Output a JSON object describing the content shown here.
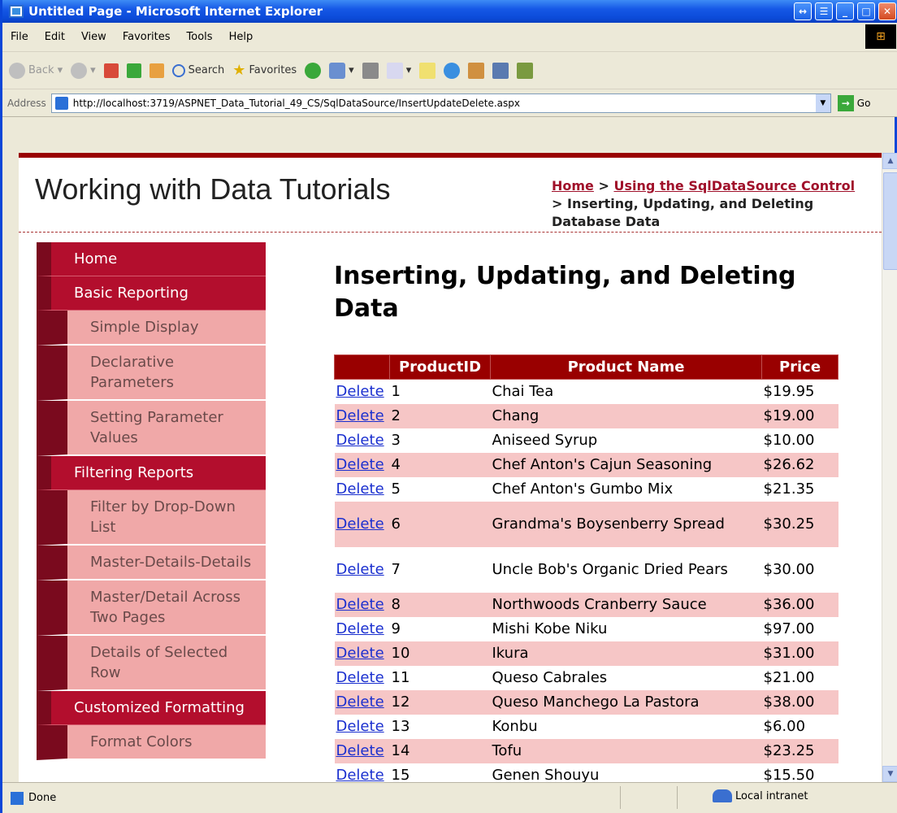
{
  "window": {
    "title": "Untitled Page - Microsoft Internet Explorer"
  },
  "menubar": {
    "items": [
      "File",
      "Edit",
      "View",
      "Favorites",
      "Tools",
      "Help"
    ]
  },
  "toolbar": {
    "back": "Back",
    "search": "Search",
    "favorites": "Favorites"
  },
  "address": {
    "label": "Address",
    "url": "http://localhost:3719/ASPNET_Data_Tutorial_49_CS/SqlDataSource/InsertUpdateDelete.aspx",
    "go": "Go"
  },
  "header": {
    "site_title": "Working with Data Tutorials",
    "crumb_home": "Home",
    "crumb_sep1": " > ",
    "crumb_section": "Using the SqlDataSource Control",
    "crumb_sep2": " > ",
    "crumb_current": "Inserting, Updating, and Deleting Database Data"
  },
  "menu": [
    {
      "label": "Home",
      "level": 1
    },
    {
      "label": "Basic Reporting",
      "level": 1
    },
    {
      "label": "Simple Display",
      "level": 2
    },
    {
      "label": "Declarative Parameters",
      "level": 2
    },
    {
      "label": "Setting Parameter Values",
      "level": 2
    },
    {
      "label": "Filtering Reports",
      "level": 1
    },
    {
      "label": "Filter by Drop-Down List",
      "level": 2
    },
    {
      "label": "Master-Details-Details",
      "level": 2
    },
    {
      "label": "Master/Detail Across Two Pages",
      "level": 2
    },
    {
      "label": "Details of Selected Row",
      "level": 2
    },
    {
      "label": "Customized Formatting",
      "level": 1
    },
    {
      "label": "Format Colors",
      "level": 2
    }
  ],
  "content": {
    "heading": "Inserting, Updating, and Deleting Data"
  },
  "grid": {
    "columns": [
      "",
      "ProductID",
      "Product Name",
      "Price"
    ],
    "delete_label": "Delete",
    "rows": [
      {
        "id": "1",
        "name": "Chai Tea",
        "price": "$19.95"
      },
      {
        "id": "2",
        "name": "Chang",
        "price": "$19.00"
      },
      {
        "id": "3",
        "name": "Aniseed Syrup",
        "price": "$10.00"
      },
      {
        "id": "4",
        "name": "Chef Anton's Cajun Seasoning",
        "price": "$26.62"
      },
      {
        "id": "5",
        "name": "Chef Anton's Gumbo Mix",
        "price": "$21.35"
      },
      {
        "id": "6",
        "name": "Grandma's Boysenberry Spread",
        "price": "$30.25"
      },
      {
        "id": "7",
        "name": "Uncle Bob's Organic Dried Pears",
        "price": "$30.00"
      },
      {
        "id": "8",
        "name": "Northwoods Cranberry Sauce",
        "price": "$36.00"
      },
      {
        "id": "9",
        "name": "Mishi Kobe Niku",
        "price": "$97.00"
      },
      {
        "id": "10",
        "name": "Ikura",
        "price": "$31.00"
      },
      {
        "id": "11",
        "name": "Queso Cabrales",
        "price": "$21.00"
      },
      {
        "id": "12",
        "name": "Queso Manchego La Pastora",
        "price": "$38.00"
      },
      {
        "id": "13",
        "name": "Konbu",
        "price": "$6.00"
      },
      {
        "id": "14",
        "name": "Tofu",
        "price": "$23.25"
      },
      {
        "id": "15",
        "name": "Genen Shouyu",
        "price": "$15.50"
      }
    ]
  },
  "status": {
    "text": "Done",
    "zone": "Local intranet"
  }
}
